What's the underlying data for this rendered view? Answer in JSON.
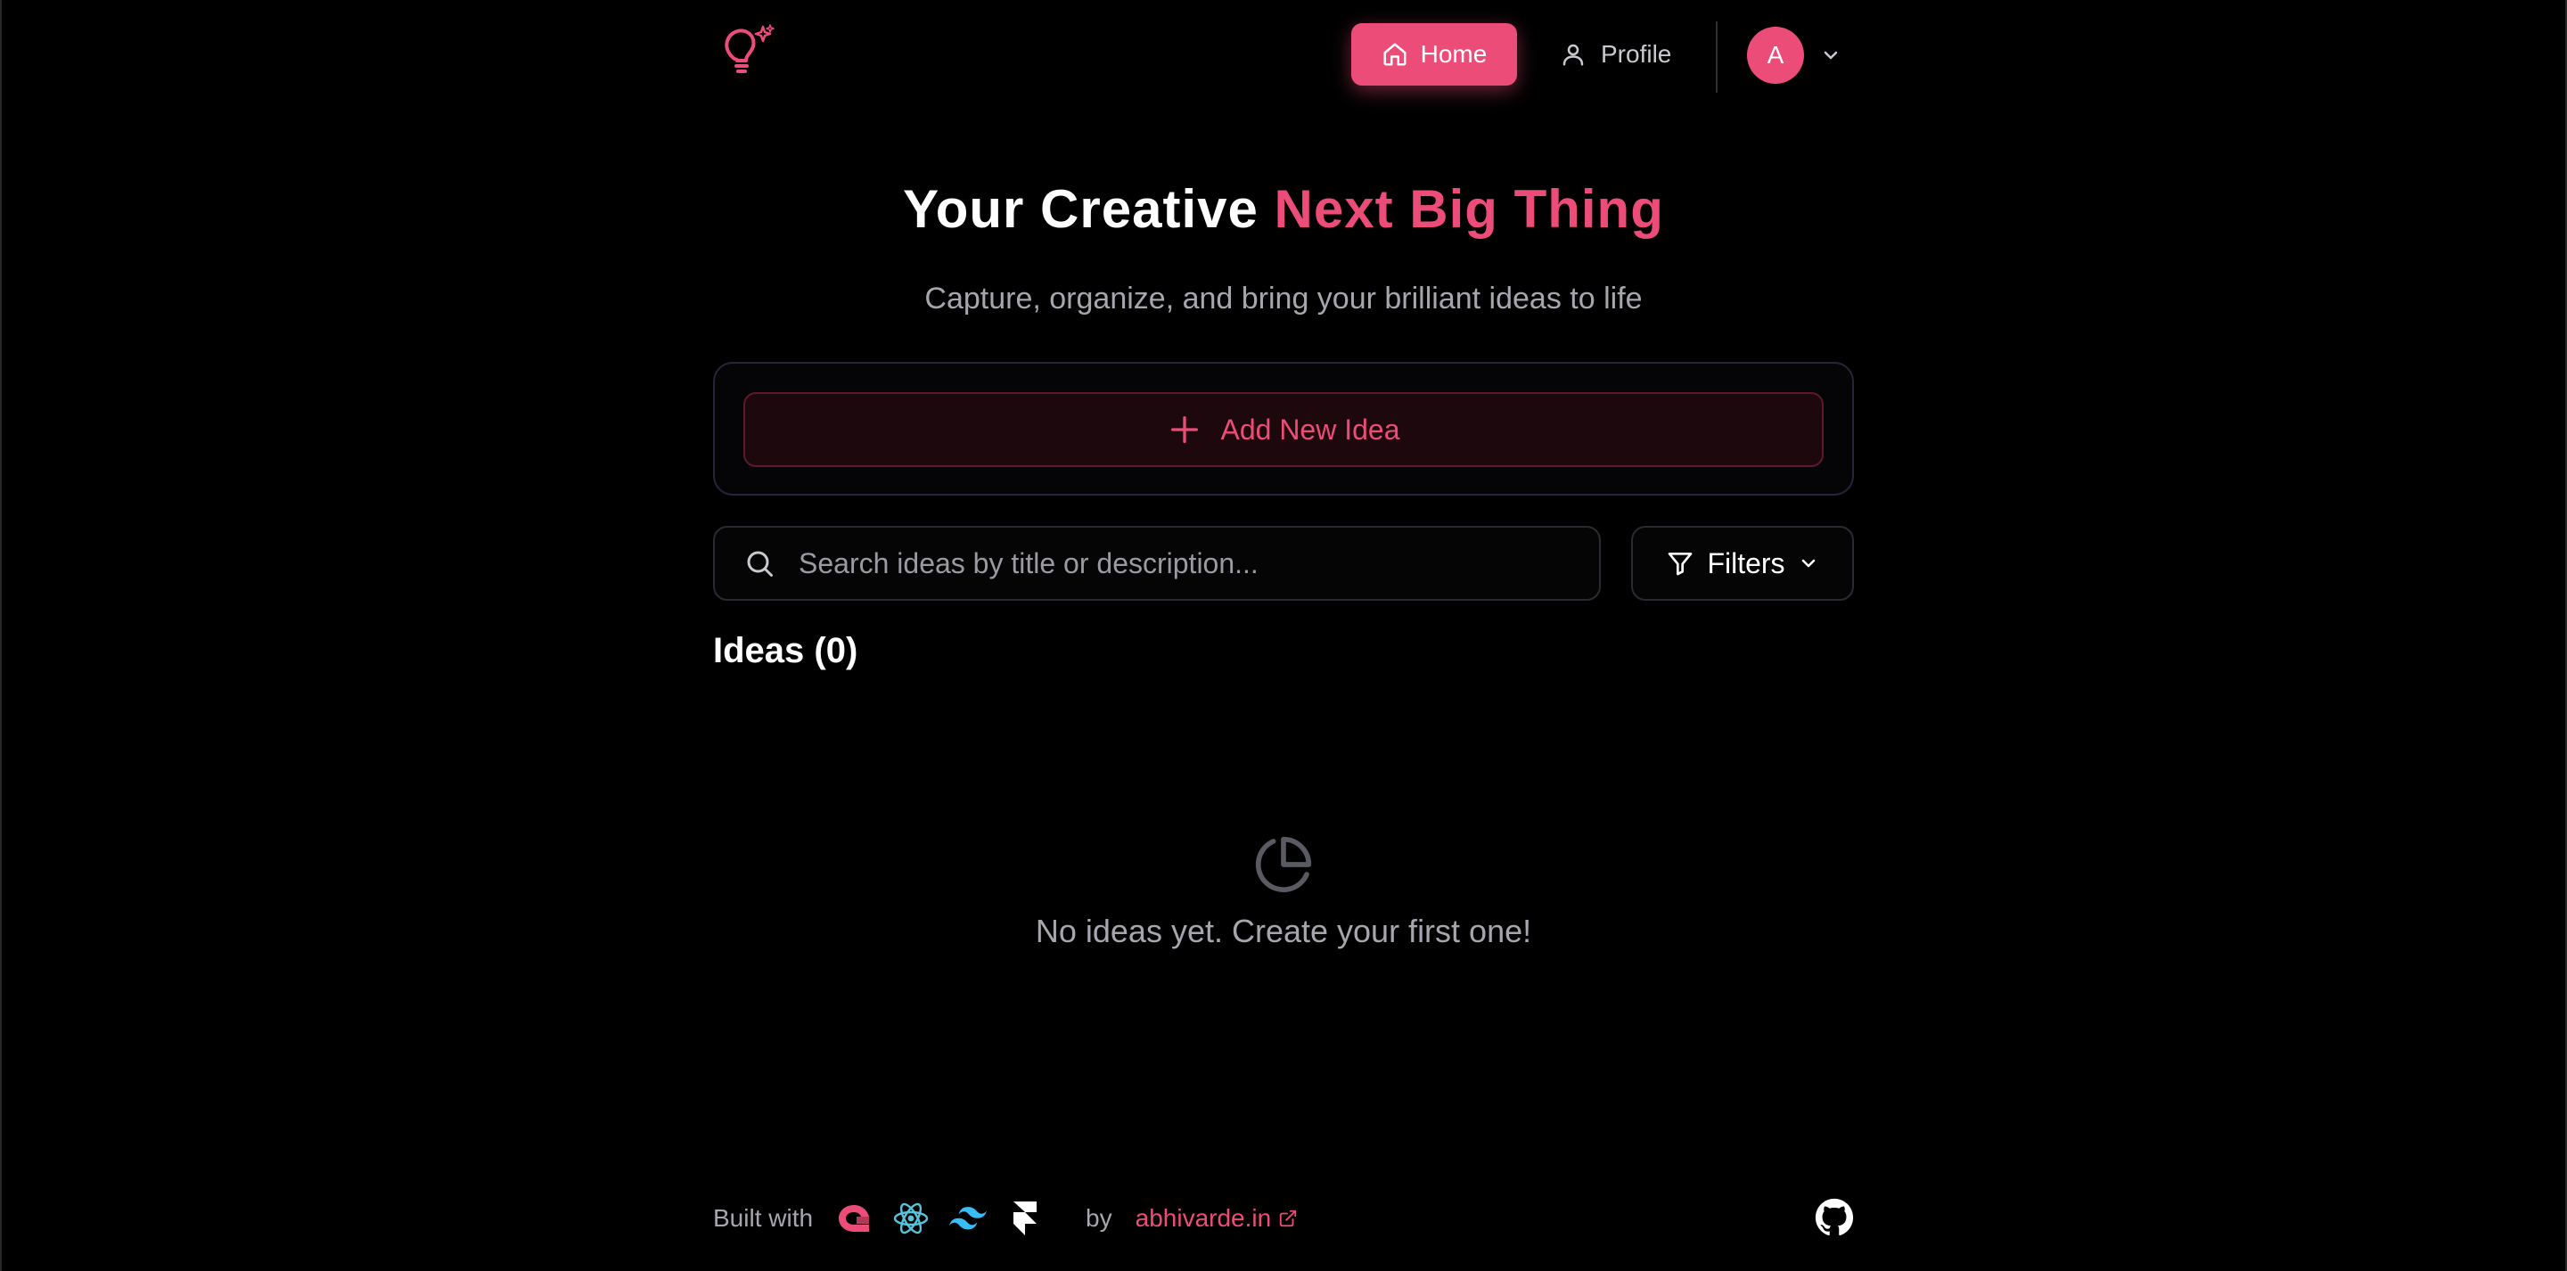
{
  "header": {
    "logo_icon": "lightbulb-sparkle-icon",
    "nav": {
      "home_label": "Home",
      "profile_label": "Profile"
    },
    "avatar_initial": "A"
  },
  "hero": {
    "title_main": "Your Creative",
    "title_accent": "Next Big Thing",
    "subtitle": "Capture, organize, and bring your brilliant ideas to life"
  },
  "add_idea": {
    "label": "Add New Idea"
  },
  "search": {
    "placeholder": "Search ideas by title or description...",
    "value": ""
  },
  "filters": {
    "label": "Filters"
  },
  "ideas": {
    "heading": "Ideas (0)",
    "empty_message": "No ideas yet. Create your first one!"
  },
  "footer": {
    "built_with": "Built with",
    "tech_icons": [
      "appwrite-icon",
      "react-icon",
      "tailwind-icon",
      "framer-icon"
    ],
    "by": "by",
    "author_link": "abhivarde.in",
    "github_icon": "github-icon"
  },
  "colors": {
    "accent": "#ec4c78",
    "background": "#000000",
    "muted_text": "#a6a6ae",
    "border": "#2a2a33"
  }
}
